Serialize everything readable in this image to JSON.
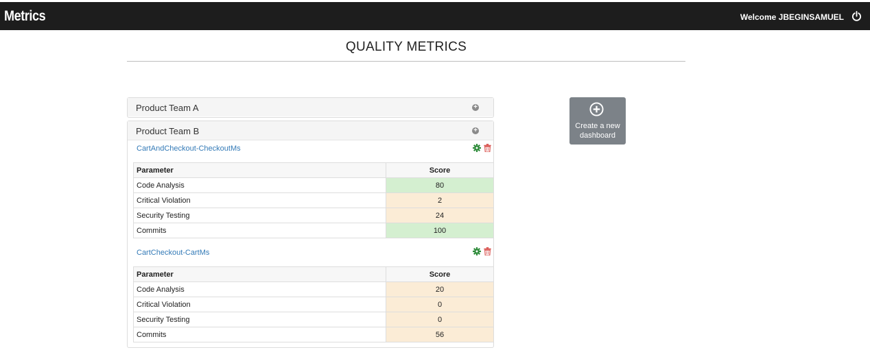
{
  "header": {
    "brand": "Metrics",
    "welcome": "Welcome JBEGINSAMUEL",
    "power_icon": "power-icon"
  },
  "page": {
    "title": "QUALITY METRICS"
  },
  "panels": [
    {
      "title": "Product Team A",
      "expand_icon": "plus-circle-icon"
    },
    {
      "title": "Product Team B",
      "expand_icon": "plus-circle-icon",
      "projects": [
        {
          "name": "CartAndCheckout-CheckoutMs",
          "columns": [
            "Parameter",
            "Score"
          ],
          "rows": [
            {
              "parameter": "Code Analysis",
              "score": "80",
              "status": "good"
            },
            {
              "parameter": "Critical Violation",
              "score": "2",
              "status": "warn"
            },
            {
              "parameter": "Security Testing",
              "score": "24",
              "status": "warn"
            },
            {
              "parameter": "Commits",
              "score": "100",
              "status": "good"
            }
          ]
        },
        {
          "name": "CartCheckout-CartMs",
          "columns": [
            "Parameter",
            "Score"
          ],
          "rows": [
            {
              "parameter": "Code Analysis",
              "score": "20",
              "status": "warn"
            },
            {
              "parameter": "Critical Violation",
              "score": "0",
              "status": "warn"
            },
            {
              "parameter": "Security Testing",
              "score": "0",
              "status": "warn"
            },
            {
              "parameter": "Commits",
              "score": "56",
              "status": "warn"
            }
          ]
        }
      ]
    }
  ],
  "create_dashboard": {
    "label_line1": "Create a new",
    "label_line2": "dashboard"
  },
  "colors": {
    "good": "#d4efd0",
    "warn": "#fbecd6",
    "gear": "#2e8b3a",
    "trash": "#d9534f",
    "link": "#337ab7"
  }
}
